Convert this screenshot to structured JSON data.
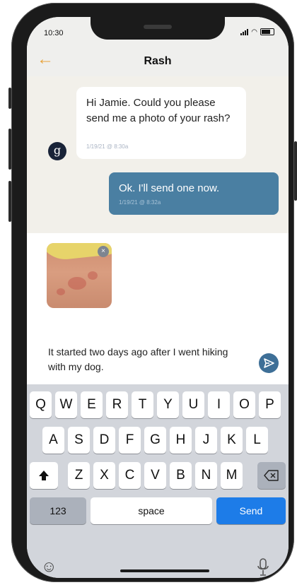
{
  "status": {
    "time": "10:30"
  },
  "header": {
    "title": "Rash"
  },
  "messages": [
    {
      "from": "provider",
      "avatar_letter": "g",
      "text": "Hi Jamie. Could you please send me a photo of your rash?",
      "timestamp": "1/19/21 @ 8:30a"
    },
    {
      "from": "user",
      "text": "Ok. I'll send one now.",
      "timestamp": "1/19/21 @ 8:32a"
    }
  ],
  "attachment": {
    "remove_glyph": "×"
  },
  "compose": {
    "text": "It started two days ago after I went hiking with my dog."
  },
  "keyboard": {
    "row1": [
      "Q",
      "W",
      "E",
      "R",
      "T",
      "Y",
      "U",
      "I",
      "O",
      "P"
    ],
    "row2": [
      "A",
      "S",
      "D",
      "F",
      "G",
      "H",
      "J",
      "K",
      "L"
    ],
    "row3": [
      "Z",
      "X",
      "C",
      "V",
      "B",
      "N",
      "M"
    ],
    "numbers_label": "123",
    "space_label": "space",
    "send_label": "Send"
  },
  "icons": {
    "back": "arrow-left-icon",
    "send": "send-icon",
    "shift": "shift-icon",
    "backspace": "backspace-icon",
    "emoji": "emoji-icon",
    "mic": "microphone-icon"
  },
  "colors": {
    "accent": "#e8a33a",
    "outgoing_bubble": "#4a7fa2",
    "send_key": "#1d7ce8",
    "avatar": "#192338"
  }
}
